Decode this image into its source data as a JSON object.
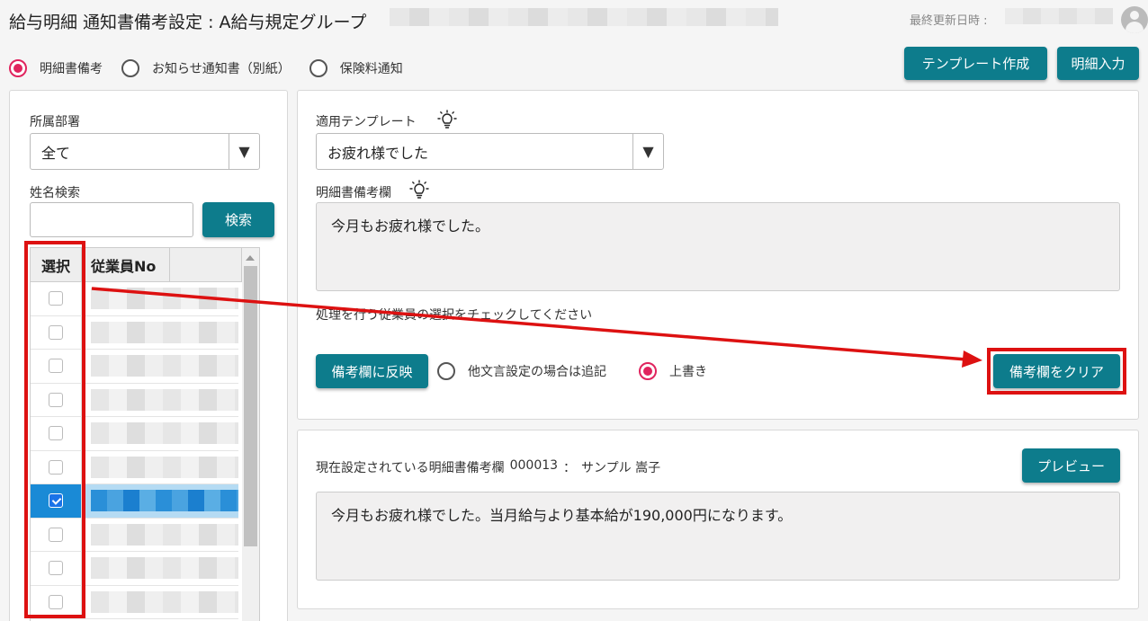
{
  "header": {
    "title": "給与明細 通知書備考設定 : A給与規定グループ",
    "updated_label": "最終更新日時 :"
  },
  "mode_radios": [
    {
      "label": "明細書備考",
      "selected": true
    },
    {
      "label": "お知らせ通知書（別紙）",
      "selected": false
    },
    {
      "label": "保険料通知",
      "selected": false
    }
  ],
  "toolbar": {
    "template_create_label": "テンプレート作成",
    "detail_input_label": "明細入力"
  },
  "filter": {
    "department_label": "所属部署",
    "department_value": "全て",
    "name_search_label": "姓名検索",
    "name_search_value": "",
    "search_button_label": "検索"
  },
  "employee_table": {
    "columns": [
      "選択",
      "従業員No"
    ],
    "rows": [
      {
        "checked": false
      },
      {
        "checked": false
      },
      {
        "checked": false
      },
      {
        "checked": false
      },
      {
        "checked": false
      },
      {
        "checked": false
      },
      {
        "checked": true
      },
      {
        "checked": false
      },
      {
        "checked": false
      },
      {
        "checked": false
      }
    ]
  },
  "template_panel": {
    "template_label": "適用テンプレート",
    "template_value": "お疲れ様でした",
    "remarks_label": "明細書備考欄",
    "remarks_value": "今月もお疲れ様でした。",
    "instruction": "処理を行う従業員の選択をチェックしてください",
    "apply_button_label": "備考欄に反映",
    "radio_append_label": "他文言設定の場合は追記",
    "radio_overwrite_label": "上書き",
    "overwrite_selected": true,
    "clear_button_label": "備考欄をクリア"
  },
  "current_panel": {
    "heading": "現在設定されている明細書備考欄",
    "employee_no": "000013",
    "separator": "：",
    "employee_name": "サンプル 嵩子",
    "preview_button_label": "プレビュー",
    "current_value": "今月もお疲れ様でした。当月給与より基本給が190,000円になります。"
  },
  "colors": {
    "accent": "#0d7c8c",
    "radio_selected": "#e0245e",
    "annotation": "#d11111",
    "selected_row": "#b5dbf3"
  }
}
